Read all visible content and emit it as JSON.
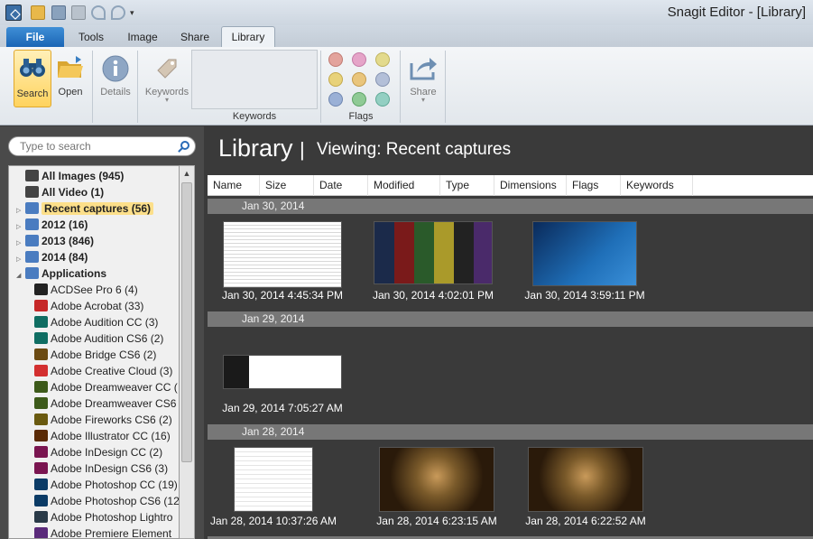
{
  "window": {
    "title": "Snagit Editor - [Library]"
  },
  "tabs": {
    "file": "File",
    "tools": "Tools",
    "image": "Image",
    "share": "Share",
    "library": "Library"
  },
  "ribbon": {
    "search": "Search",
    "open": "Open",
    "details": "Details",
    "keywords": "Keywords",
    "keywords_group": "Keywords",
    "flags_group": "Flags",
    "share": "Share"
  },
  "search": {
    "placeholder": "Type to search"
  },
  "tree": [
    {
      "label": "All Images (945)",
      "bold": true,
      "icon": "camera-icon"
    },
    {
      "label": "All Video (1)",
      "bold": true,
      "icon": "video-icon"
    },
    {
      "label": "Recent captures (56)",
      "bold": true,
      "selected": true,
      "icon": "clock-icon"
    },
    {
      "label": "2012 (16)",
      "bold": true,
      "icon": "calendar-icon"
    },
    {
      "label": "2013 (846)",
      "bold": true,
      "icon": "calendar-icon"
    },
    {
      "label": "2014 (84)",
      "bold": true,
      "icon": "calendar-icon"
    },
    {
      "label": "Applications",
      "bold": true,
      "icon": "folder-icon"
    },
    {
      "label": "ACDSee Pro 6 (4)",
      "icon": "acdsee-icon"
    },
    {
      "label": "Adobe Acrobat  (33)",
      "icon": "acrobat-icon"
    },
    {
      "label": "Adobe Audition CC (3)",
      "icon": "audition-icon"
    },
    {
      "label": "Adobe Audition CS6 (2)",
      "icon": "audition-icon"
    },
    {
      "label": "Adobe Bridge CS6 (2)",
      "icon": "bridge-icon"
    },
    {
      "label": "Adobe Creative Cloud (3)",
      "icon": "creative-cloud-icon"
    },
    {
      "label": "Adobe Dreamweaver CC (",
      "icon": "dreamweaver-icon"
    },
    {
      "label": "Adobe Dreamweaver CS6",
      "icon": "dreamweaver-icon"
    },
    {
      "label": "Adobe Fireworks CS6 (2)",
      "icon": "fireworks-icon"
    },
    {
      "label": "Adobe Illustrator CC (16)",
      "icon": "illustrator-icon"
    },
    {
      "label": "Adobe InDesign CC (2)",
      "icon": "indesign-icon"
    },
    {
      "label": "Adobe InDesign CS6 (3)",
      "icon": "indesign-icon"
    },
    {
      "label": "Adobe Photoshop CC (19)",
      "icon": "photoshop-icon"
    },
    {
      "label": "Adobe Photoshop CS6 (12",
      "icon": "photoshop-icon"
    },
    {
      "label": "Adobe Photoshop Lightro",
      "icon": "lightroom-icon"
    },
    {
      "label": "Adobe Premiere Element",
      "icon": "premiere-icon"
    }
  ],
  "main": {
    "title": "Library",
    "separator": "|",
    "viewing": "Viewing: Recent captures",
    "columns": [
      "Name",
      "Size",
      "Date",
      "Modified",
      "Type",
      "Dimensions",
      "Flags",
      "Keywords"
    ],
    "groups": [
      {
        "label": "Jan 30, 2014",
        "items": [
          "Jan 30, 2014 4:45:34 PM",
          "Jan 30, 2014 4:02:01 PM",
          "Jan 30, 2014 3:59:11 PM"
        ]
      },
      {
        "label": "Jan 29, 2014",
        "items": [
          "Jan 29, 2014 7:05:27 AM"
        ]
      },
      {
        "label": "Jan 28, 2014",
        "items": [
          "Jan 28, 2014 10:37:26 AM",
          "Jan 28, 2014 6:23:15 AM",
          "Jan 28, 2014 6:22:52 AM"
        ]
      }
    ]
  }
}
